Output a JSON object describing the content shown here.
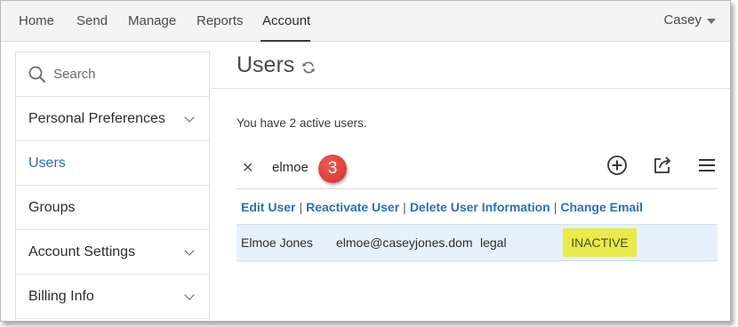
{
  "nav": {
    "items": [
      "Home",
      "Send",
      "Manage",
      "Reports",
      "Account"
    ],
    "active": "Account",
    "user": "Casey"
  },
  "sidebar": {
    "search_placeholder": "Search",
    "items": [
      {
        "label": "Personal Preferences",
        "expandable": true
      },
      {
        "label": "Users",
        "active": true
      },
      {
        "label": "Groups"
      },
      {
        "label": "Account Settings",
        "expandable": true
      },
      {
        "label": "Billing Info",
        "expandable": true
      }
    ]
  },
  "main": {
    "title": "Users",
    "active_users_text": "You have 2 active users.",
    "filter": {
      "value": "elmoe",
      "step_number": "3"
    },
    "actions": [
      "Edit User",
      "Reactivate User",
      "Delete User Information",
      "Change Email"
    ],
    "rows": [
      {
        "name": "Elmoe Jones",
        "email": "elmoe@caseyjones.dom",
        "group": "legal",
        "status": "INACTIVE"
      }
    ]
  },
  "colors": {
    "link": "#2d6eb6",
    "status_inactive_bg": "#e8eb4a",
    "row_selected_bg": "#e7f1fb",
    "step_badge": "#e0403a"
  },
  "icons": [
    "search-icon",
    "refresh-icon",
    "close-icon",
    "add-circle-icon",
    "share-icon",
    "menu-icon",
    "chevron-down-icon"
  ]
}
